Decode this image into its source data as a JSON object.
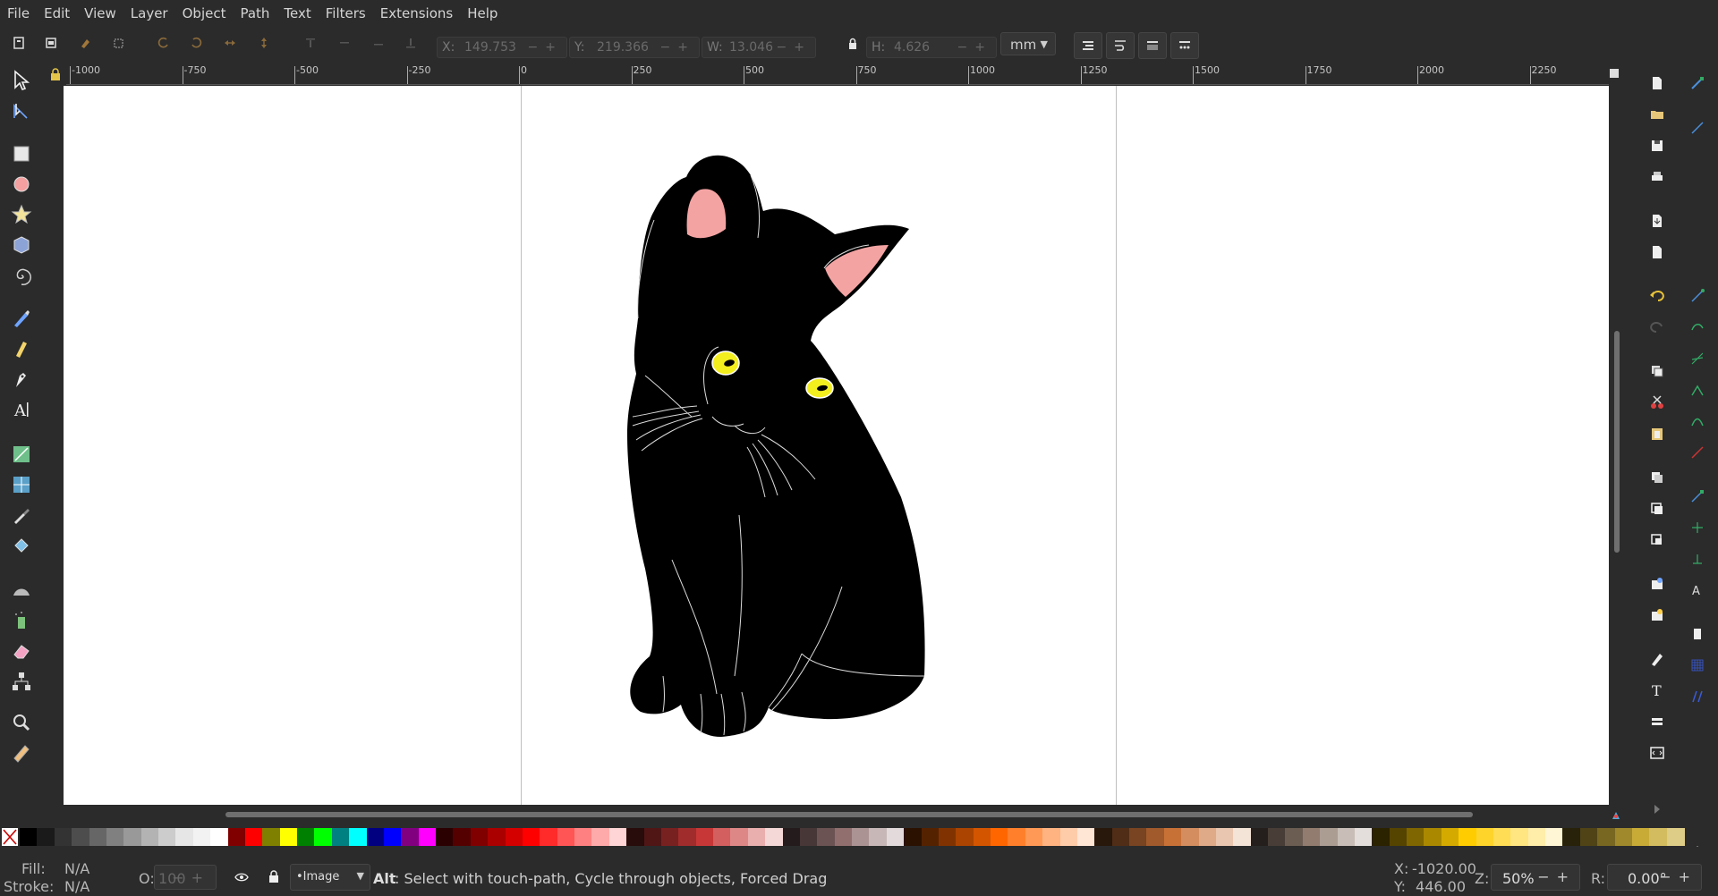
{
  "menu": [
    "File",
    "Edit",
    "View",
    "Layer",
    "Object",
    "Path",
    "Text",
    "Filters",
    "Extensions",
    "Help"
  ],
  "toolbar": {
    "x_label": "X:",
    "x_value": "149.753",
    "y_label": "Y:",
    "y_value": "219.366",
    "w_label": "W:",
    "w_value": "13.046",
    "h_label": "H:",
    "h_value": "4.626",
    "unit": "mm"
  },
  "ruler": {
    "top_labels": [
      "-1000",
      "-750",
      "-500",
      "-250",
      "0",
      "250",
      "500",
      "750",
      "1000",
      "1250",
      "1500",
      "1750",
      "2000",
      "2250"
    ]
  },
  "left_tools": [
    "selector-icon",
    "node-tool-icon",
    "rectangle-tool-icon",
    "ellipse-tool-icon",
    "star-tool-icon",
    "3d-box-tool-icon",
    "spiral-tool-icon",
    "pencil-tool-icon",
    "pen-tool-icon",
    "calligraphy-tool-icon",
    "text-tool-icon",
    "gradient-tool-icon",
    "mesh-tool-icon",
    "dropper-tool-icon",
    "paint-bucket-icon",
    "tweak-tool-icon",
    "spray-tool-icon",
    "eraser-tool-icon",
    "connector-tool-icon",
    "zoom-tool-icon",
    "measure-tool-icon"
  ],
  "status": {
    "fill_label": "Fill:",
    "fill_value": "N/A",
    "stroke_label": "Stroke:",
    "stroke_value": "N/A",
    "opacity_label": "O:",
    "opacity_value": "100",
    "layer_name": "•Image",
    "message_key": "Alt",
    "message": ": Select with touch-path, Cycle through objects, Forced Drag",
    "cursor_x_label": "X:",
    "cursor_x": "-1020.00",
    "cursor_y_label": "Y:",
    "cursor_y": "446.00",
    "zoom_label": "Z:",
    "zoom": "50%",
    "rotate_label": "R:",
    "rotate": "0.00°"
  },
  "palette": [
    "#000000",
    "#1a1a1a",
    "#333333",
    "#4d4d4d",
    "#666666",
    "#808080",
    "#999999",
    "#b3b3b3",
    "#cccccc",
    "#e6e6e6",
    "#f2f2f2",
    "#ffffff",
    "#800000",
    "#ff0000",
    "#808000",
    "#ffff00",
    "#008000",
    "#00ff00",
    "#008080",
    "#00ffff",
    "#000080",
    "#0000ff",
    "#800080",
    "#ff00ff",
    "#2b0000",
    "#550000",
    "#800000",
    "#aa0000",
    "#d40000",
    "#ff0000",
    "#ff2a2a",
    "#ff5555",
    "#ff8080",
    "#ffaaaa",
    "#ffd5d5",
    "#280b0b",
    "#501616",
    "#782121",
    "#a02c2c",
    "#c83737",
    "#d35f5f",
    "#de8787",
    "#e9afaf",
    "#f4d7d7",
    "#241c1c",
    "#483737",
    "#6c5353",
    "#916f6f",
    "#ac9393",
    "#c8b7b7",
    "#e3dbdb",
    "#2b1100",
    "#552200",
    "#803300",
    "#aa4400",
    "#d45500",
    "#ff6600",
    "#ff7f2a",
    "#ff9955",
    "#ffb380",
    "#ffccaa",
    "#ffe6d5",
    "#28170b",
    "#502d16",
    "#784421",
    "#a05a2c",
    "#c87137",
    "#d38d5f",
    "#deaa87",
    "#e9c6af",
    "#f4e3d7",
    "#241f1c",
    "#483e37",
    "#6c5d53",
    "#917c6f",
    "#ac9d93",
    "#c8beb7",
    "#e3dedb",
    "#2b2200",
    "#554400",
    "#806600",
    "#aa8800",
    "#d4aa00",
    "#ffcc00",
    "#ffd42a",
    "#ffdd55",
    "#ffe680",
    "#ffeeaa",
    "#fff6d5",
    "#28220b",
    "#504416",
    "#786721",
    "#a0892c",
    "#c8ab37",
    "#d3bc5f",
    "#decd87"
  ]
}
